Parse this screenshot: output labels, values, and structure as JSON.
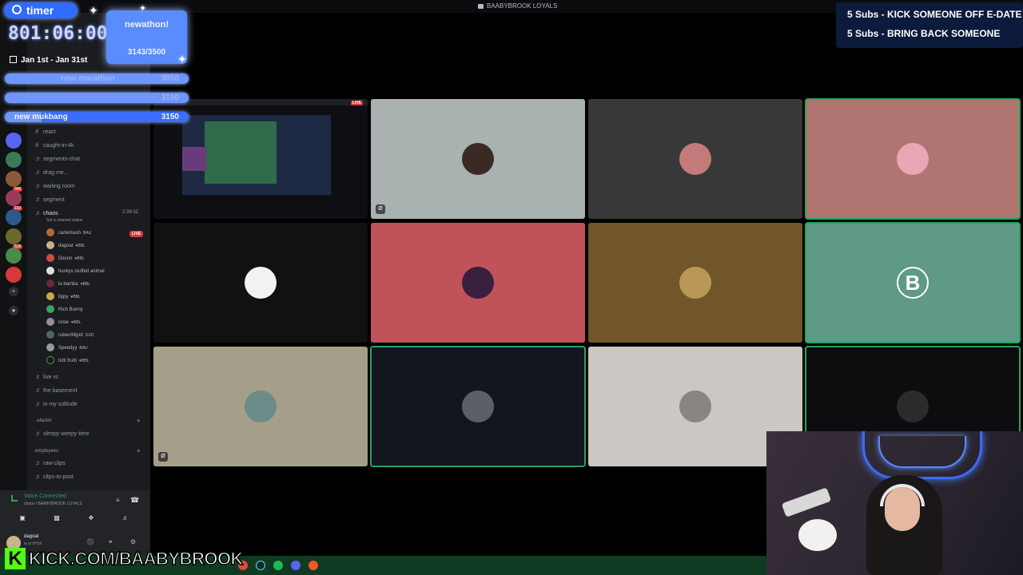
{
  "window": {
    "title": "BAABYBROOK LOYALS"
  },
  "overlays": {
    "timer": {
      "label": "timer",
      "value": "801:06:00",
      "date_range": "Jan 1st - Jan 31st"
    },
    "newathon": {
      "title": "newathon!",
      "progress": "3143/3500"
    },
    "goals": [
      {
        "name": "new marathon",
        "value": "3050",
        "faded": true
      },
      {
        "name": "",
        "value": "3100",
        "faded": true
      },
      {
        "name": "new mukbang",
        "value": "3150",
        "faded": false
      }
    ],
    "subs_lines": [
      "5 Subs - KICK SOMEONE OFF E-DATE",
      "5 Subs - BRING BACK SOMEONE"
    ],
    "kick_url": "KICK.COM/BAABYBROOK",
    "kick_letter": "K"
  },
  "sidebar": {
    "channels": [
      {
        "label": "react",
        "type": "text"
      },
      {
        "label": "caught-in-4k",
        "type": "text"
      },
      {
        "label": "segments-chat",
        "type": "voice"
      },
      {
        "label": "drag me...",
        "type": "voice"
      },
      {
        "label": "waiting room",
        "type": "voice"
      },
      {
        "label": "segment",
        "type": "voice"
      }
    ],
    "active_voice": {
      "label": "chaos",
      "time": "2:39:32",
      "status": "Set a channel status"
    },
    "voice_users": [
      {
        "name": "carterkash",
        "tag": "BAU",
        "color": "#b06a3a"
      },
      {
        "name": "dagoat",
        "tag": "BBL",
        "color": "#c9b38a"
      },
      {
        "name": "Decon",
        "tag": "BBL",
        "color": "#d34a3a"
      },
      {
        "name": "huskys stuffed animal",
        "tag": "",
        "color": "#e0e0e0"
      },
      {
        "name": "la bamba",
        "tag": "BBL",
        "color": "#6a2a3a"
      },
      {
        "name": "lippy",
        "tag": "BBL",
        "color": "#c9a84a"
      },
      {
        "name": "Rich Bunny",
        "tag": "",
        "color": "#3ba55d"
      },
      {
        "name": "rosie",
        "tag": "BBL",
        "color": "#9a8a9a"
      },
      {
        "name": "ruben/lilgxd",
        "tag": "GXD",
        "color": "#4a6a5a"
      },
      {
        "name": "Speedyy",
        "tag": "BAU",
        "color": "#9a9a9a"
      },
      {
        "name": "tutti frutti",
        "tag": "BBL",
        "color": "#1a1a1a"
      }
    ],
    "live_label": "LIVE",
    "more_channels": [
      {
        "label": "live vc"
      },
      {
        "label": "the basement"
      },
      {
        "label": "in my solitude"
      }
    ],
    "category_ulackin": "ulackin",
    "sleepy": "sleepy weepy time",
    "category_employees": "employees",
    "employee_channels": [
      {
        "label": "raw-clips"
      },
      {
        "label": "clips-to-post"
      }
    ]
  },
  "voice_panel": {
    "status": "Voice Connected",
    "channel": "chaos / BAABYBROOK LOYALS"
  },
  "user_panel": {
    "name": "dagoat",
    "status": "w ur b*tch"
  },
  "stage": {
    "tiles": [
      {
        "kind": "screen",
        "bg": "#0d0f13",
        "speaking": false,
        "live": "LIVE"
      },
      {
        "kind": "avatar",
        "bg": "#a9b1b1",
        "avatar_color": "#3b2a24",
        "speaking": false
      },
      {
        "kind": "avatar",
        "bg": "#383838",
        "avatar_color": "#c27a7a",
        "speaking": false
      },
      {
        "kind": "avatar",
        "bg": "#b07571",
        "avatar_color": "#e7a7b5",
        "speaking": true
      },
      {
        "kind": "avatar",
        "bg": "#111111",
        "avatar_color": "#f2f2f2",
        "speaking": false
      },
      {
        "kind": "avatar",
        "bg": "#c05359",
        "avatar_color": "#3a1f3f",
        "speaking": false
      },
      {
        "kind": "avatar",
        "bg": "#705629",
        "avatar_color": "#b99855",
        "speaking": false
      },
      {
        "kind": "letter",
        "bg": "#5e9a86",
        "letter": "B",
        "speaking": true
      },
      {
        "kind": "avatar",
        "bg": "#a59f89",
        "avatar_color": "#6b8c88",
        "speaking": false
      },
      {
        "kind": "avatar",
        "bg": "#13161f",
        "avatar_color": "#5b5f66",
        "speaking": true
      },
      {
        "kind": "avatar",
        "bg": "#cbc8c3",
        "avatar_color": "#8a8580",
        "speaking": false
      },
      {
        "kind": "avatar",
        "bg": "#0d0d0f",
        "avatar_color": "#2b2b2e",
        "speaking": true
      }
    ]
  }
}
